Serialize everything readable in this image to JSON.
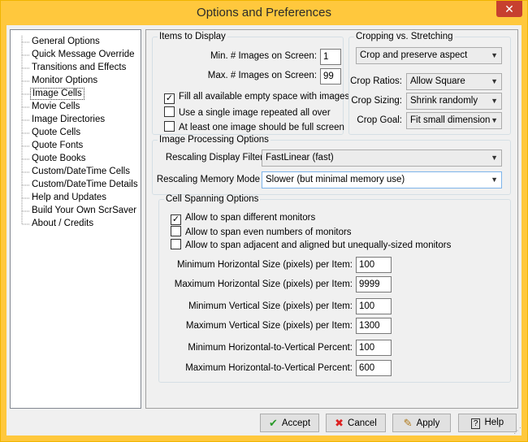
{
  "window": {
    "title": "Options and Preferences",
    "close_glyph": "✕"
  },
  "tree": {
    "items": [
      "General Options",
      "Quick Message Override",
      "Transitions and Effects",
      "Monitor Options",
      "Image Cells",
      "Movie Cells",
      "Image Directories",
      "Quote Cells",
      "Quote Fonts",
      "Quote Books",
      "Custom/DateTime Cells",
      "Custom/DateTime Details",
      "Help and Updates",
      "Build Your Own ScrSaver",
      "About / Credits"
    ],
    "selected": "Image Cells"
  },
  "items_to_display": {
    "legend": "Items to Display",
    "min_label": "Min. # Images on Screen:",
    "min_value": "1",
    "max_label": "Max. # Images on Screen:",
    "max_value": "99",
    "fill_label": "Fill all available empty space with images",
    "fill_checked": true,
    "single_label": "Use a single image repeated all over",
    "single_checked": false,
    "full_label": "At least one image should be full screen",
    "full_checked": false
  },
  "cropping": {
    "legend": "Cropping vs. Stretching",
    "mode_value": "Crop and preserve aspect",
    "ratios_label": "Crop Ratios:",
    "ratios_value": "Allow Square",
    "sizing_label": "Crop Sizing:",
    "sizing_value": "Shrink randomly",
    "goal_label": "Crop Goal:",
    "goal_value": "Fit small dimension"
  },
  "processing": {
    "legend": "Image Processing Options",
    "filter_label": "Rescaling Display Filter",
    "filter_value": "FastLinear (fast)",
    "memory_label": "Rescaling Memory Mode",
    "memory_value": "Slower (but minimal memory use)"
  },
  "spanning": {
    "legend": "Cell Spanning Options",
    "span_diff_label": "Allow to span different monitors",
    "span_diff_checked": true,
    "span_even_label": "Allow to span even numbers of monitors",
    "span_even_checked": false,
    "span_adj_label": "Allow to span adjacent and aligned but unequally-sized monitors",
    "span_adj_checked": false,
    "min_h_label": "Minimum Horizontal Size (pixels) per Item:",
    "min_h_value": "100",
    "max_h_label": "Maximum Horizontal Size (pixels) per Item:",
    "max_h_value": "9999",
    "min_v_label": "Minimum Vertical Size (pixels) per Item:",
    "min_v_value": "100",
    "max_v_label": "Maximum Vertical Size (pixels) per Item:",
    "max_v_value": "1300",
    "min_hv_label": "Minimum Horizontal-to-Vertical  Percent:",
    "min_hv_value": "100",
    "max_hv_label": "Maximum Horizontal-to-Vertical  Percent:",
    "max_hv_value": "600"
  },
  "buttons": {
    "accept": "Accept",
    "cancel": "Cancel",
    "apply": "Apply",
    "help": "Help",
    "accept_icon": "check-icon",
    "cancel_icon": "x-icon",
    "apply_icon": "pencil-icon",
    "help_icon": "question-icon"
  },
  "colors": {
    "title_bar": "#ffc83d",
    "close": "#c7402f",
    "dialog": "#f0f0f0"
  }
}
